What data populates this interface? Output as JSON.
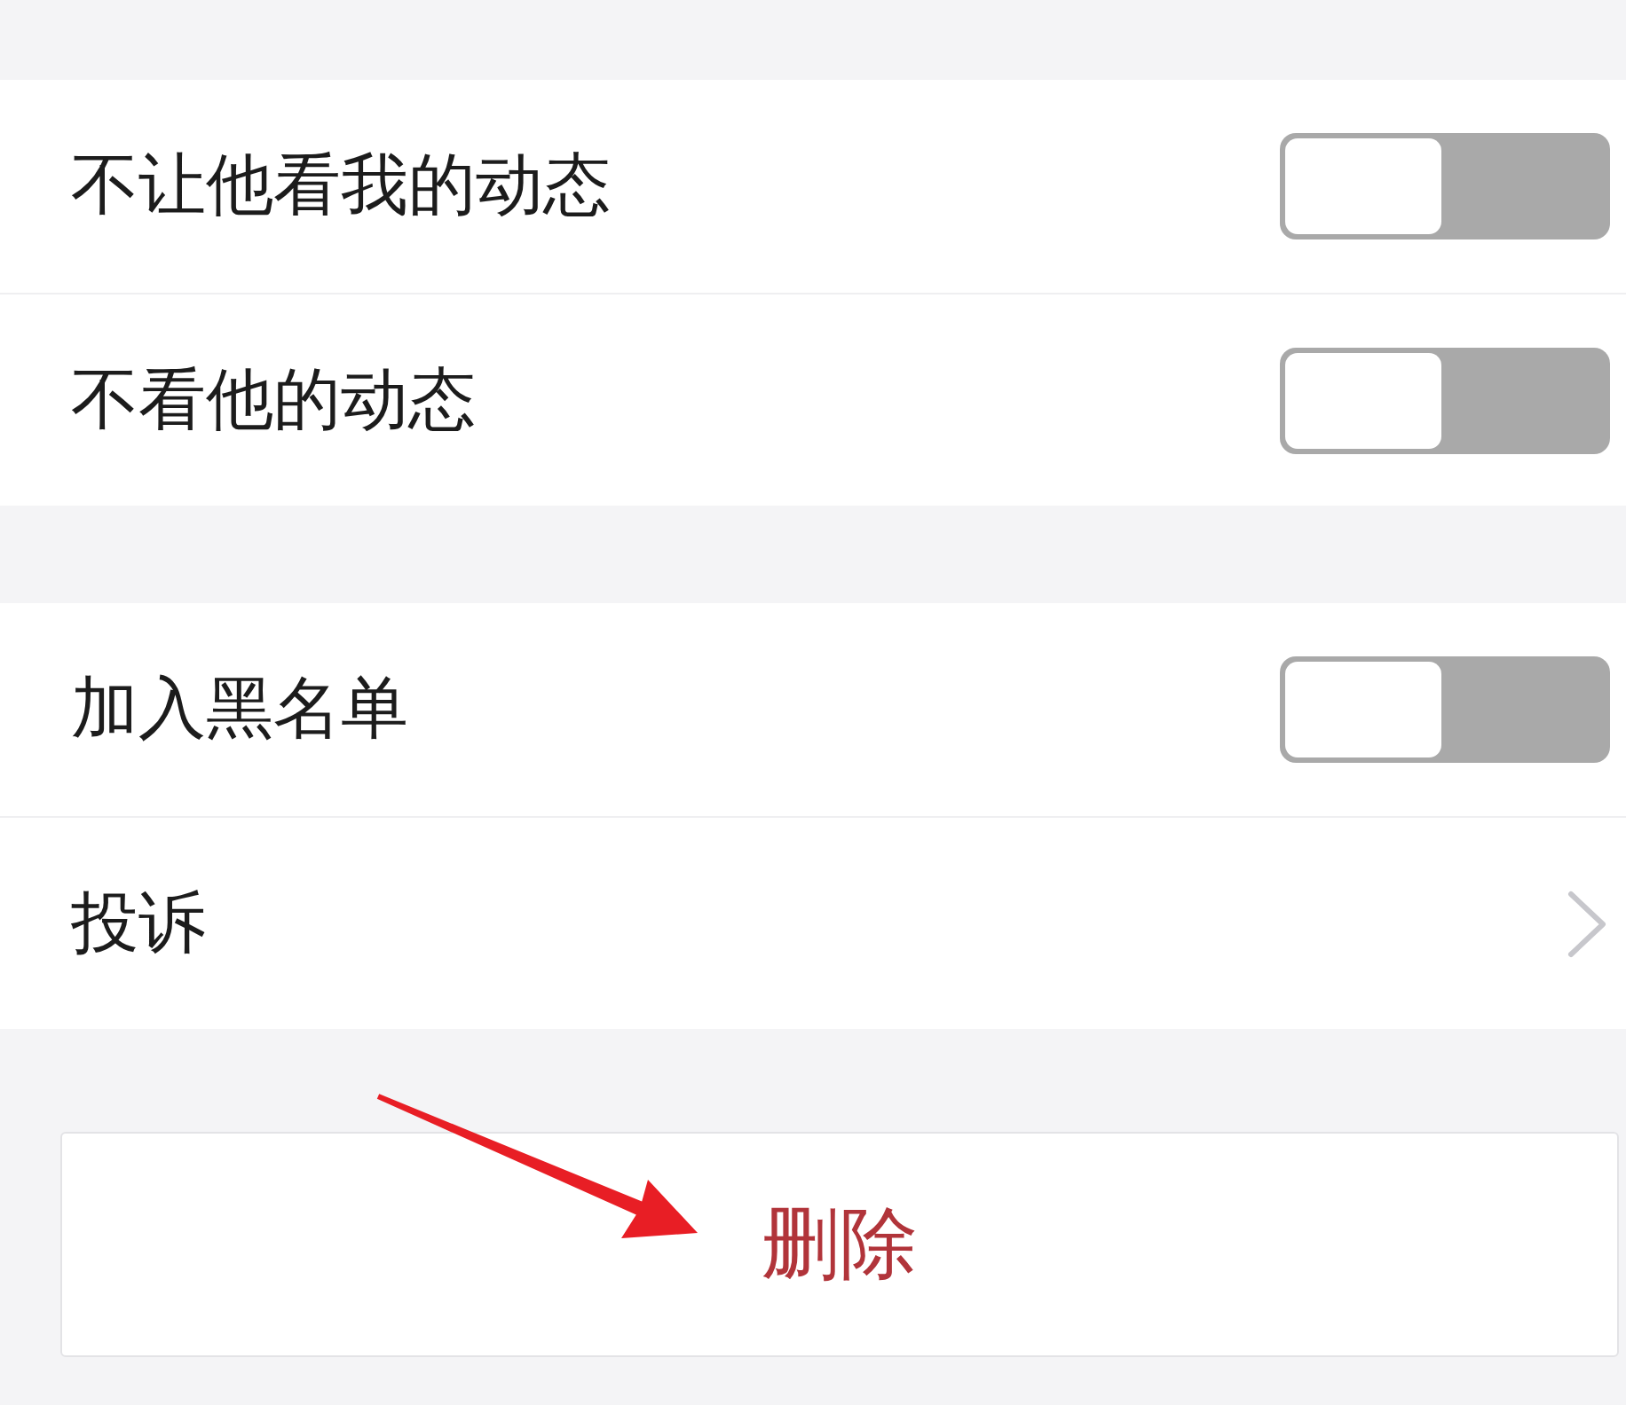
{
  "sections": [
    {
      "rows": [
        {
          "kind": "toggle",
          "label": "不让他看我的动态",
          "on": false
        },
        {
          "kind": "toggle",
          "label": "不看他的动态",
          "on": false
        }
      ]
    },
    {
      "rows": [
        {
          "kind": "toggle",
          "label": "加入黑名单",
          "on": false
        },
        {
          "kind": "link",
          "label": "投诉"
        }
      ]
    }
  ],
  "delete_button": {
    "label": "删除"
  },
  "annotations": [
    {
      "kind": "arrow"
    }
  ]
}
